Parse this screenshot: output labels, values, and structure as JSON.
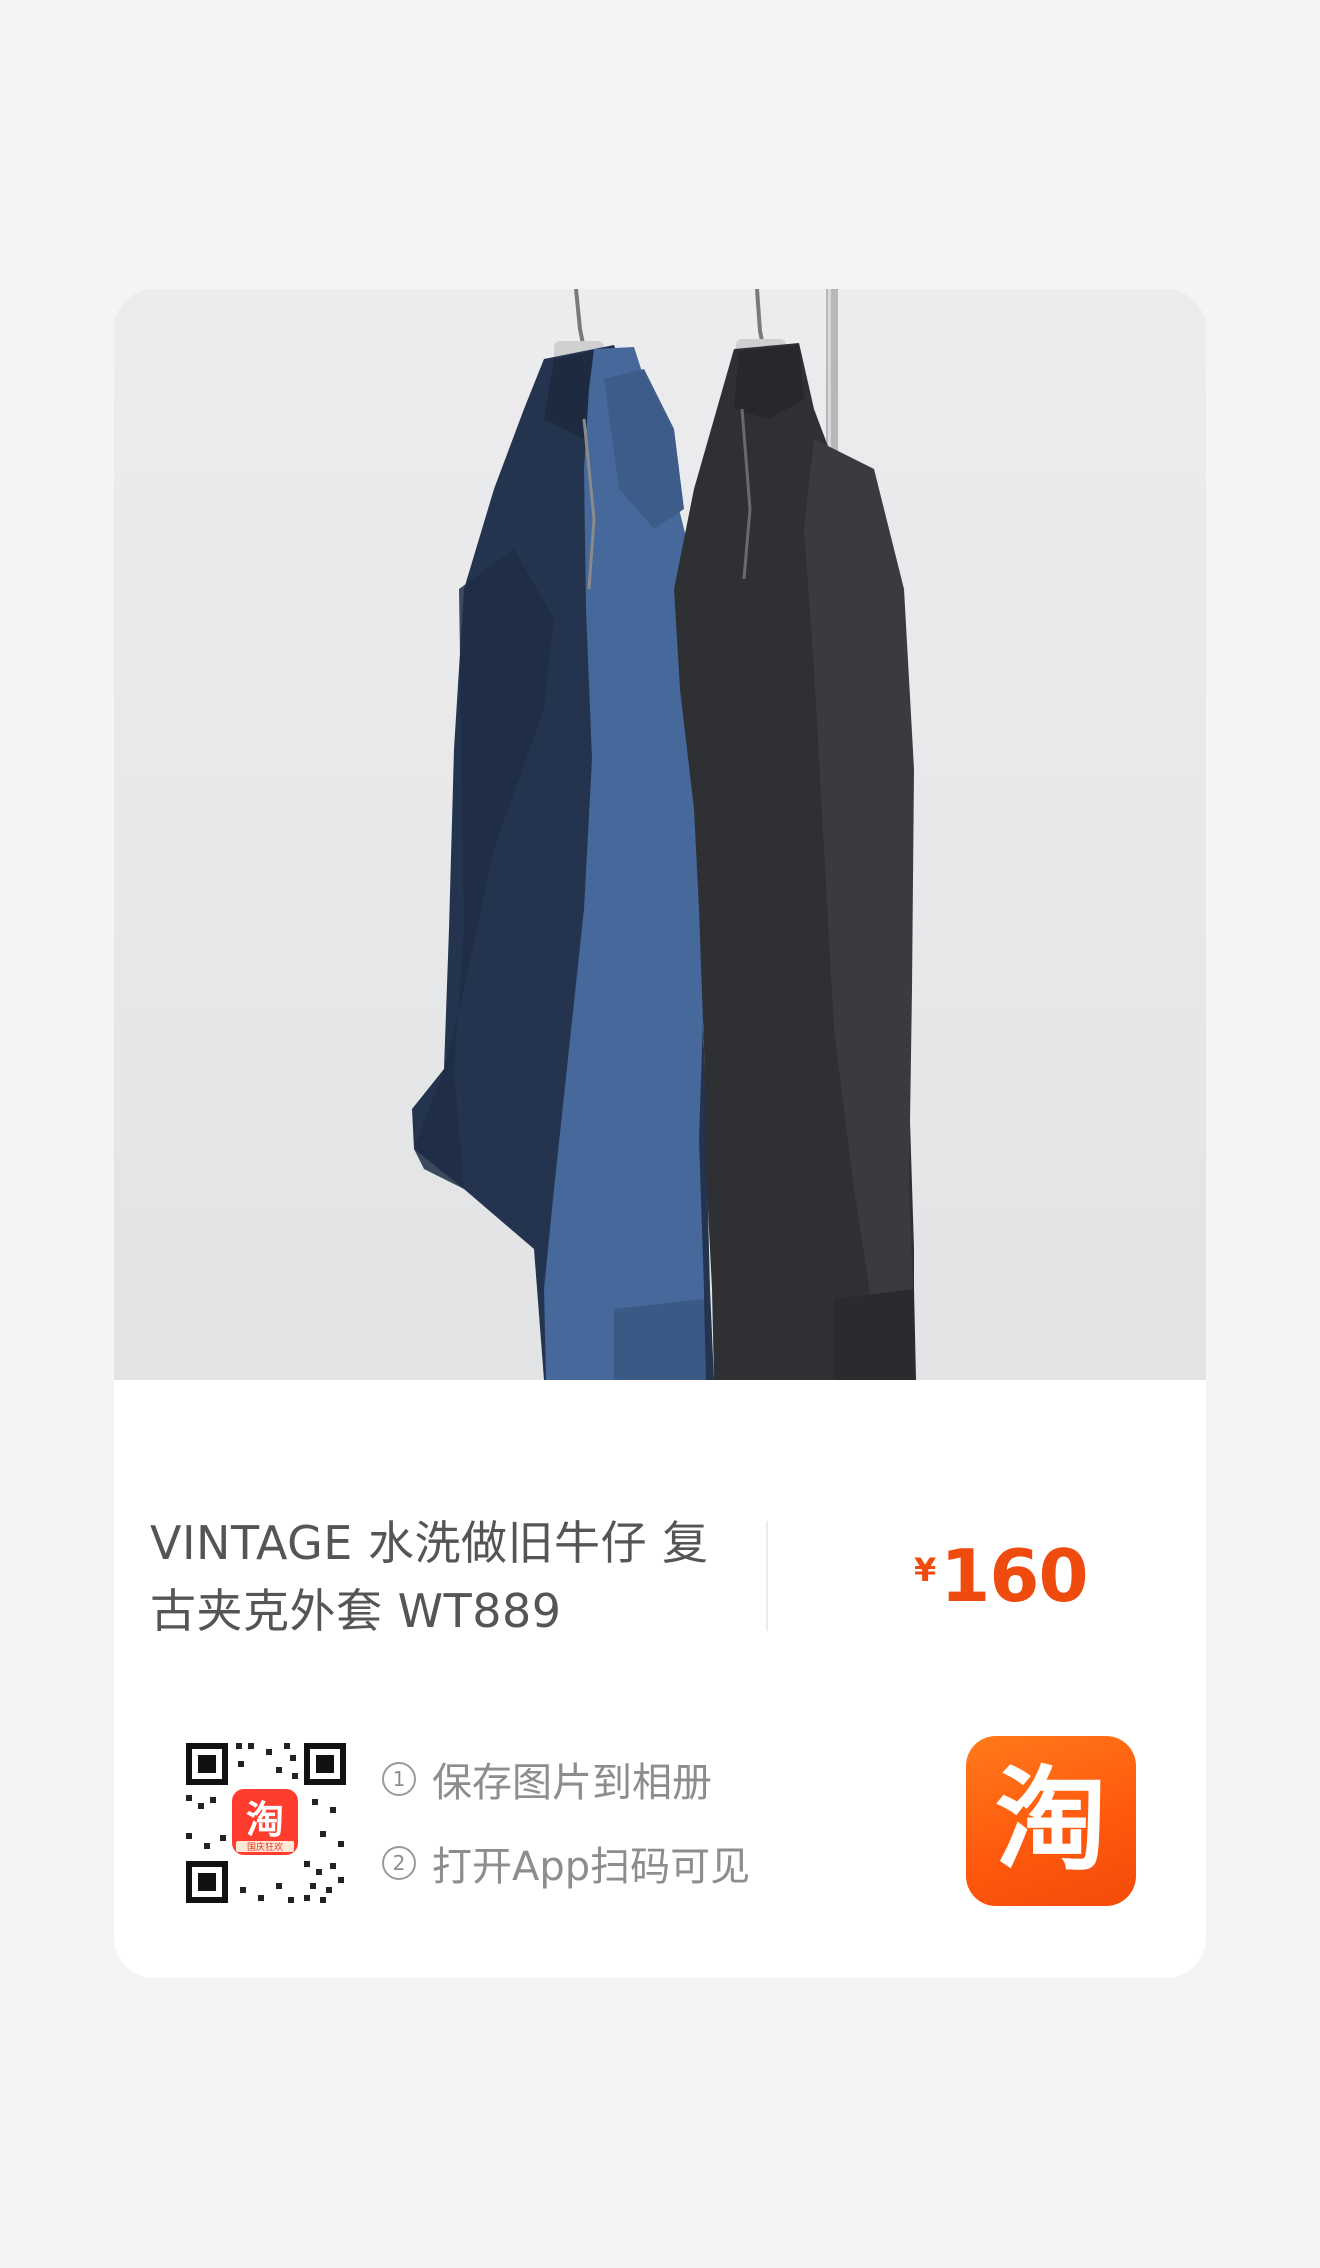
{
  "product": {
    "title": "VINTAGE 水洗做旧牛仔 复古夹克外套 WT889",
    "price_currency": "¥",
    "price_amount": "160"
  },
  "instructions": {
    "step1_num": "1",
    "step1_text": "保存图片到相册",
    "step2_num": "2",
    "step2_text": "打开App扫码可见"
  },
  "qr": {
    "center_badge_glyph": "淘",
    "center_badge_caption": "国庆狂欢"
  },
  "brand": {
    "logo_glyph": "淘"
  },
  "colors": {
    "price": "#ef4b0f",
    "logo_orange": "#ff5a0e",
    "background": "#f4f4f4",
    "card": "#ffffff"
  }
}
